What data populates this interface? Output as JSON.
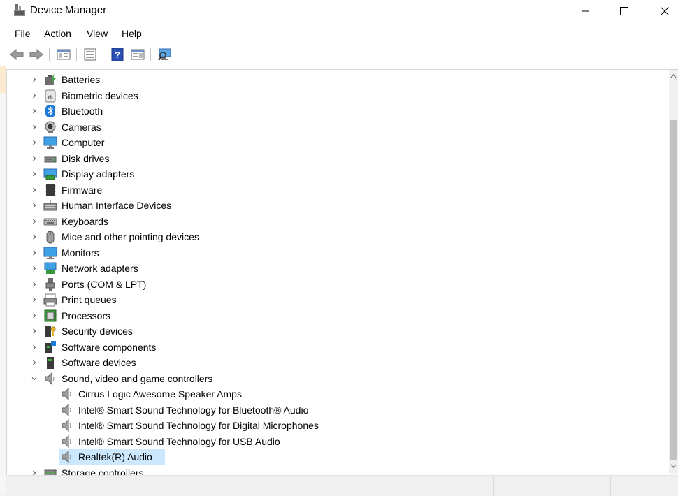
{
  "window": {
    "title": "Device Manager",
    "minimize_icon": "minimize-icon",
    "maximize_icon": "maximize-icon",
    "close_icon": "close-icon"
  },
  "menu": [
    "File",
    "Action",
    "View",
    "Help"
  ],
  "toolbar": {
    "icons": [
      "back-arrow-icon",
      "forward-arrow-icon",
      "show-hide-console-tree-icon",
      "properties-icon",
      "help-icon",
      "action-pane-icon",
      "scan-hardware-icon"
    ]
  },
  "tree": {
    "categories": [
      {
        "label": "Batteries",
        "icon": "battery-icon"
      },
      {
        "label": "Biometric devices",
        "icon": "fingerprint-icon"
      },
      {
        "label": "Bluetooth",
        "icon": "bluetooth-icon"
      },
      {
        "label": "Cameras",
        "icon": "camera-icon"
      },
      {
        "label": "Computer",
        "icon": "computer-icon"
      },
      {
        "label": "Disk drives",
        "icon": "disk-drive-icon"
      },
      {
        "label": "Display adapters",
        "icon": "display-adapter-icon"
      },
      {
        "label": "Firmware",
        "icon": "firmware-icon"
      },
      {
        "label": "Human Interface Devices",
        "icon": "hid-icon"
      },
      {
        "label": "Keyboards",
        "icon": "keyboard-icon"
      },
      {
        "label": "Mice and other pointing devices",
        "icon": "mouse-icon"
      },
      {
        "label": "Monitors",
        "icon": "monitor-icon"
      },
      {
        "label": "Network adapters",
        "icon": "network-adapter-icon"
      },
      {
        "label": "Ports (COM & LPT)",
        "icon": "port-icon"
      },
      {
        "label": "Print queues",
        "icon": "printer-icon"
      },
      {
        "label": "Processors",
        "icon": "processor-icon"
      },
      {
        "label": "Security devices",
        "icon": "security-device-icon"
      },
      {
        "label": "Software components",
        "icon": "software-component-icon"
      },
      {
        "label": "Software devices",
        "icon": "software-device-icon"
      },
      {
        "label": "Sound, video and game controllers",
        "icon": "speaker-icon",
        "expanded": true
      }
    ],
    "sound_children": [
      {
        "label": "Cirrus Logic Awesome Speaker Amps"
      },
      {
        "label": "Intel® Smart Sound Technology for Bluetooth® Audio"
      },
      {
        "label": "Intel® Smart Sound Technology for Digital Microphones"
      },
      {
        "label": "Intel® Smart Sound Technology for USB Audio"
      },
      {
        "label": "Realtek(R) Audio",
        "selected": true
      }
    ],
    "partial_next": {
      "label": "Storage controllers",
      "icon": "storage-controller-icon"
    }
  },
  "colors": {
    "selection": "#cce8ff",
    "accent_blue": "#1e78d7"
  }
}
